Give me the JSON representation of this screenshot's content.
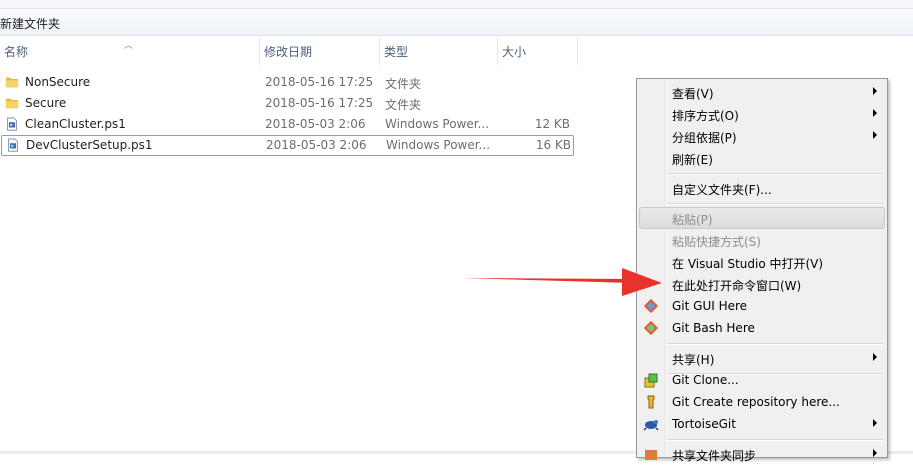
{
  "address_bar": {
    "path": "新建文件夹"
  },
  "columns": {
    "name": "名称",
    "date": "修改日期",
    "type": "类型",
    "size": "大小"
  },
  "files": [
    {
      "name": "NonSecure",
      "date": "2018-05-16 17:25",
      "type": "文件夹",
      "size": "",
      "icon": "folder-icon"
    },
    {
      "name": "Secure",
      "date": "2018-05-16 17:25",
      "type": "文件夹",
      "size": "",
      "icon": "folder-icon"
    },
    {
      "name": "CleanCluster.ps1",
      "date": "2018-05-03 2:06",
      "type": "Windows Power...",
      "size": "12 KB",
      "icon": "powershell-file-icon"
    },
    {
      "name": "DevClusterSetup.ps1",
      "date": "2018-05-03 2:06",
      "type": "Windows Power...",
      "size": "16 KB",
      "icon": "powershell-file-icon",
      "selected": true
    }
  ],
  "context_menu": {
    "items": [
      {
        "label": "查看(V)",
        "submenu": true
      },
      {
        "label": "排序方式(O)",
        "submenu": true
      },
      {
        "label": "分组依据(P)",
        "submenu": true
      },
      {
        "label": "刷新(E)"
      },
      {
        "label": "自定义文件夹(F)..."
      },
      {
        "label": "粘贴(P)",
        "disabled": true,
        "hover": true
      },
      {
        "label": "粘贴快捷方式(S)",
        "disabled": true
      },
      {
        "label": "在 Visual Studio 中打开(V)"
      },
      {
        "label": "在此处打开命令窗口(W)"
      },
      {
        "label": "Git GUI Here",
        "icon": "git-gui-icon"
      },
      {
        "label": "Git Bash Here",
        "icon": "git-bash-icon"
      },
      {
        "label": "共享(H)",
        "submenu": true
      },
      {
        "label": "Git Clone...",
        "icon": "tortoisegit-clone-icon"
      },
      {
        "label": "Git Create repository here...",
        "icon": "tortoisegit-create-repo-icon"
      },
      {
        "label": "TortoiseGit",
        "icon": "tortoisegit-icon",
        "submenu": true
      },
      {
        "label": "共享文件夹同步",
        "submenu": true,
        "partially_visible": true
      }
    ]
  },
  "annotation": {
    "arrow_color": "#e8332d"
  }
}
